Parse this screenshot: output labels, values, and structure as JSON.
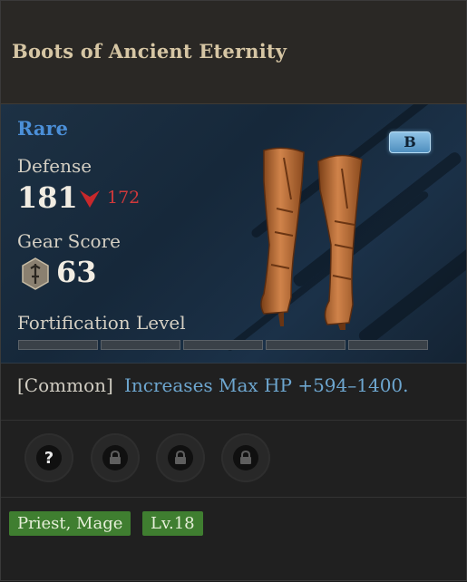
{
  "item": {
    "name": "Boots of Ancient Eternity",
    "rarity": "Rare",
    "grade": "B",
    "rarity_color": "#4b8fd8"
  },
  "stats": {
    "defense_label": "Defense",
    "defense_value": "181",
    "defense_compare": "172",
    "gear_score_label": "Gear Score",
    "gear_score_value": "63",
    "fortification_label": "Fortification Level",
    "fortification_segments": 5,
    "fortification_filled": 0
  },
  "effect": {
    "tag": "[Common]",
    "text": "Increases Max HP +594–1400."
  },
  "sockets": [
    {
      "icon": "question-icon"
    },
    {
      "icon": "lock-icon"
    },
    {
      "icon": "lock-icon"
    },
    {
      "icon": "lock-icon"
    }
  ],
  "requirements": {
    "classes": "Priest, Mage",
    "level": "Lv.18"
  },
  "colors": {
    "down": "#d0393b",
    "effect_text": "#6da6cf",
    "tag_bg": "#3f7e30"
  }
}
